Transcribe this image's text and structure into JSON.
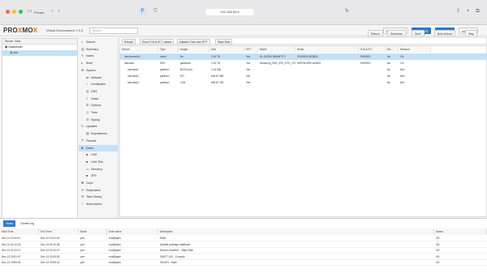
{
  "browser": {
    "tab_label": "Private",
    "url": "192.168.55.8"
  },
  "header": {
    "product": "Virtual Environment 7.3-3",
    "search_placeholder": "Search",
    "documentation": "Documentation",
    "create_vm": "Create VM",
    "create_ct": "Create CT",
    "user": "root@pam"
  },
  "server_view": {
    "label": "Server View",
    "datacenter": "Datacenter",
    "node": "pve"
  },
  "node_title": "Node 'pve'",
  "node_actions": {
    "reboot": "Reboot",
    "shutdown": "Shutdown",
    "shell": "Shell",
    "bulk": "Bulk Actions",
    "help": "Help"
  },
  "node_menu": [
    {
      "label": "Search",
      "icon": "search-icon",
      "indent": false
    },
    {
      "label": "Summary",
      "icon": "summary-icon",
      "indent": false
    },
    {
      "label": "Notes",
      "icon": "notes-icon",
      "indent": false
    },
    {
      "label": "Shell",
      "icon": "terminal-icon",
      "indent": false
    },
    {
      "label": "System",
      "icon": "gear-icon",
      "indent": false
    },
    {
      "label": "Network",
      "icon": "network-icon",
      "indent": true
    },
    {
      "label": "Certificates",
      "icon": "certificate-icon",
      "indent": true
    },
    {
      "label": "DNS",
      "icon": "globe-icon",
      "indent": true
    },
    {
      "label": "Hosts",
      "icon": "hosts-icon",
      "indent": true
    },
    {
      "label": "Options",
      "icon": "gear-icon",
      "indent": true
    },
    {
      "label": "Time",
      "icon": "clock-icon",
      "indent": true
    },
    {
      "label": "Syslog",
      "icon": "list-icon",
      "indent": true
    },
    {
      "label": "Updates",
      "icon": "refresh-icon",
      "indent": false
    },
    {
      "label": "Repositories",
      "icon": "repository-icon",
      "indent": true
    },
    {
      "label": "Firewall",
      "icon": "shield-icon",
      "indent": false
    },
    {
      "label": "Disks",
      "icon": "disk-icon",
      "indent": false
    },
    {
      "label": "LVM",
      "icon": "square-icon",
      "indent": true
    },
    {
      "label": "LVM-Thin",
      "icon": "square-icon",
      "indent": true
    },
    {
      "label": "Directory",
      "icon": "folder-icon",
      "indent": true
    },
    {
      "label": "ZFS",
      "icon": "square-icon",
      "indent": true
    },
    {
      "label": "Ceph",
      "icon": "ceph-icon",
      "indent": false
    },
    {
      "label": "Replication",
      "icon": "replication-icon",
      "indent": false
    },
    {
      "label": "Task History",
      "icon": "list-icon",
      "indent": false
    },
    {
      "label": "Subscription",
      "icon": "support-icon",
      "indent": false
    }
  ],
  "disk_toolbar": {
    "reload": "Reload",
    "smart": "Show S.M.A.R.T. values",
    "gpt": "Initialize Disk with GPT",
    "wipe": "Wipe Disk"
  },
  "disk_columns": [
    "Device",
    "Type",
    "Usage",
    "Size",
    "GPT",
    "Model",
    "Serial",
    "S.M.A.R.T.",
    "Mo...",
    "Wearout"
  ],
  "disk_rows": [
    [
      "/dev/nvme0n1",
      "nvme",
      "No",
      "2.04 TB",
      "Yes",
      "HL-SN750 2BBHP1T1",
      "2CM0205 5E3800",
      "PASSED",
      "No",
      "2%"
    ],
    [
      "/dev/sda",
      "SSD",
      "partitions",
      "1.00 TB",
      "Yes",
      "Samsung_SSD_870_EVO_1TB",
      "S6PZNJ0R9 164691",
      "PASSED",
      "No",
      "1%"
    ],
    [
      "/dev/sda1",
      "partition",
      "BIOS boot",
      "1.03 MB",
      "Yes",
      "",
      "",
      "",
      "No",
      "N/A"
    ],
    [
      "/dev/sda2",
      "partition",
      "EFI",
      "536.87 MB",
      "Yes",
      "",
      "",
      "",
      "No",
      "N/A"
    ],
    [
      "/dev/sda3",
      "partition",
      "LVM",
      "999.67 GB",
      "Yes",
      "",
      "",
      "",
      "No",
      "N/A"
    ]
  ],
  "bottom_tabs": {
    "tasks": "Tasks",
    "cluster_log": "Cluster log"
  },
  "task_columns": [
    "Start Time",
    "End Time",
    "Node",
    "User name",
    "Description",
    "Status"
  ],
  "task_rows": [
    [
      "Dec 14 10:40:11",
      "Dec 14 10:41:40",
      "pve",
      "root@pam",
      "Shell",
      "OK"
    ],
    [
      "Dec 14 01:10:24",
      "Dec 14 01:10:48",
      "pve",
      "root@pam",
      "Update package database",
      "OK"
    ],
    [
      "Dec 13 21:20:27",
      "Dec 13 21:20:27",
      "pve",
      "root@pam",
      "Device nvme0n1 - Wipe Disk",
      "OK"
    ],
    [
      "Dec 13 20:51:07",
      "Dec 13 20:53:05",
      "pve",
      "root@pam",
      "VM/CT 100 - Console",
      "OK"
    ],
    [
      "Dec 13 19:55:28",
      "Dec 13 19:55:41",
      "pve",
      "root@pam",
      "VM 601 - Start",
      "OK"
    ]
  ]
}
